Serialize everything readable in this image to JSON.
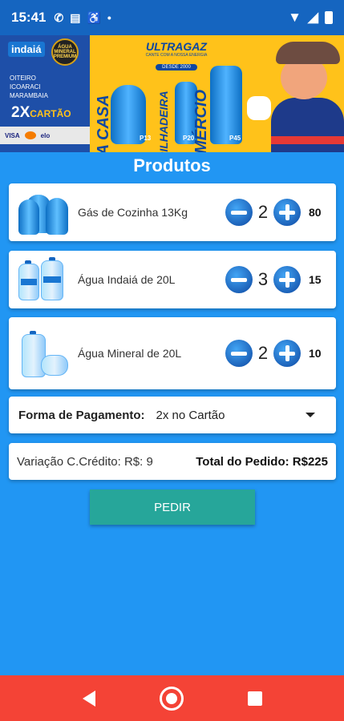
{
  "status_bar": {
    "time": "15:41",
    "icons": [
      "whatsapp-icon",
      "news-icon",
      "accessibility-icon",
      "dot-icon",
      "wifi-icon",
      "signal-icon",
      "battery-icon"
    ]
  },
  "banner": {
    "brand_indaia": "indaiá",
    "badge_text": "ÁGUA MINERAL PREMIUM",
    "cities": [
      "OITEIRO",
      "ICOARACI",
      "MARAMBAIA"
    ],
    "installments": "2X",
    "installments_label": "CARTÃO",
    "cards": [
      "VISA",
      "elo"
    ],
    "brand_ultragaz": "ULTRAGAZ",
    "brand_sub": "CANTE COM A NOSSA ENERGIA",
    "since": "DESDE 2000",
    "word_home": "SUA CASA",
    "word_forklift": "EMPILHADEIRA",
    "word_commerce": "COMÉRCIO",
    "cylinders": [
      "P13",
      "P20",
      "P45"
    ]
  },
  "title": "Produtos",
  "products": [
    {
      "name": "Gás de Cozinha 13Kg",
      "quantity": "2",
      "stock": "80",
      "image": "gas-cylinder"
    },
    {
      "name": "Água Indaiá de 20L",
      "quantity": "3",
      "stock": "15",
      "image": "water-jug"
    },
    {
      "name": "Água Mineral de 20L",
      "quantity": "2",
      "stock": "10",
      "image": "water-jug"
    }
  ],
  "payment": {
    "label": "Forma de Pagamento:",
    "selected": "2x no Cartão"
  },
  "summary": {
    "variation": "Variação C.Crédito: R$: 9",
    "total": "Total do Pedido: R$225"
  },
  "order_button": "PEDIR",
  "colors": {
    "background": "#2196f3",
    "status_bar": "#1565c0",
    "order_button": "#26a69a",
    "nav_bar": "#f44336",
    "stepper": "#1565c0"
  }
}
